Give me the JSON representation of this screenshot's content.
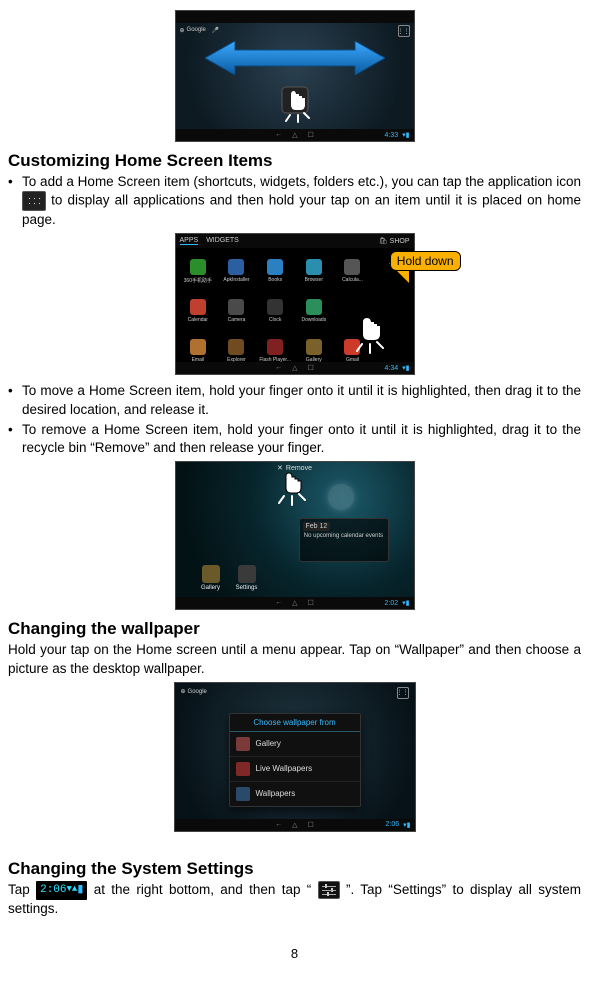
{
  "page_number": "8",
  "sections": {
    "customizing": {
      "heading": "Customizing Home Screen Items",
      "bullet1_pre": "To add a Home Screen item (shortcuts, widgets, folders etc.), you can tap the application icon ",
      "bullet1_post": " to display all applications and then hold your tap on an item until it is placed on home page.",
      "bullet2": "To move a Home Screen item, hold your finger onto it until it is highlighted, then drag it to the desired location, and release it.",
      "bullet3": "To remove a Home Screen item, hold your finger onto it until it is highlighted, drag it to the recycle bin “Remove” and then release your finger."
    },
    "wallpaper": {
      "heading": "Changing the wallpaper",
      "body": "Hold your tap on the Home screen until a menu appear. Tap on “Wallpaper” and then choose a picture as the desktop wallpaper."
    },
    "settings": {
      "heading": "Changing the System Settings",
      "body_pre": "Tap ",
      "body_mid": " at the right bottom, and then tap “",
      "body_post": "”. Tap “Settings” to display all system settings."
    }
  },
  "callout": {
    "label": "Hold down"
  },
  "screenshot1": {
    "search_label": "Google",
    "clock": "4:33",
    "nav": [
      "←",
      "△",
      "☐"
    ]
  },
  "screenshot2": {
    "tabs": {
      "apps": "APPS",
      "widgets": "WIDGETS"
    },
    "shop": "SHOP",
    "clock": "4:34",
    "apps": [
      {
        "label": "360手机助手",
        "color": "#2a8f2a"
      },
      {
        "label": "ApkInstaller",
        "color": "#2a5fa0"
      },
      {
        "label": "Books",
        "color": "#2a80c0"
      },
      {
        "label": "Browser",
        "color": "#2a8faf"
      },
      {
        "label": "Calcula...",
        "color": "#555555"
      },
      {
        "label": "",
        "color": "transparent"
      },
      {
        "label": "Calendar",
        "color": "#c04030"
      },
      {
        "label": "Camera",
        "color": "#4a4a4a"
      },
      {
        "label": "Clock",
        "color": "#333333"
      },
      {
        "label": "Downloads",
        "color": "#2a8f5a"
      },
      {
        "label": "",
        "color": "transparent"
      },
      {
        "label": "",
        "color": "transparent"
      },
      {
        "label": "Email",
        "color": "#b07030"
      },
      {
        "label": "Explorer",
        "color": "#704a20"
      },
      {
        "label": "Flash Player...",
        "color": "#802020"
      },
      {
        "label": "Gallery",
        "color": "#7a602a"
      },
      {
        "label": "Gmail",
        "color": "#cc3a2a"
      },
      {
        "label": "",
        "color": "transparent"
      }
    ]
  },
  "screenshot3": {
    "remove_label": "Remove",
    "widget_date": "Feb 12",
    "widget_text": "No upcoming calendar events",
    "clock": "2:02",
    "desk": [
      {
        "label": "Gallery",
        "color": "#6a5a2a"
      },
      {
        "label": "Settings",
        "color": "#3a3a3a"
      }
    ]
  },
  "screenshot4": {
    "dialog_title": "Choose wallpaper from",
    "options": [
      {
        "label": "Gallery",
        "color": "#7a3a3a"
      },
      {
        "label": "Live Wallpapers",
        "color": "#802828"
      },
      {
        "label": "Wallpapers",
        "color": "#2a4a6a"
      }
    ],
    "search_label": "Google",
    "clock": "2:06"
  },
  "status_badge": {
    "time": "2:06",
    "symbols": "▼▲"
  }
}
